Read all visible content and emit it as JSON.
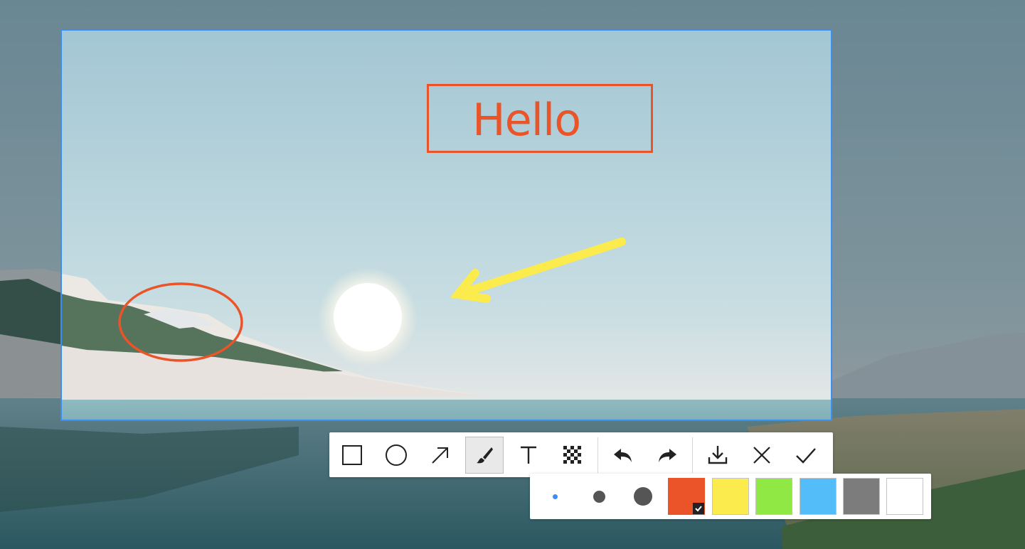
{
  "annotation": {
    "text": "Hello"
  },
  "toolbar": {
    "tools": [
      {
        "name": "rectangle-tool",
        "icon": "square-icon",
        "active": false
      },
      {
        "name": "ellipse-tool",
        "icon": "circle-icon",
        "active": false
      },
      {
        "name": "arrow-tool",
        "icon": "arrow-icon",
        "active": false
      },
      {
        "name": "brush-tool",
        "icon": "brush-icon",
        "active": true
      },
      {
        "name": "text-tool",
        "icon": "text-icon",
        "active": false
      },
      {
        "name": "mosaic-tool",
        "icon": "mosaic-icon",
        "active": false
      }
    ],
    "history": [
      {
        "name": "undo-button",
        "icon": "undo-icon"
      },
      {
        "name": "redo-button",
        "icon": "redo-icon"
      }
    ],
    "actions": [
      {
        "name": "save-button",
        "icon": "download-icon"
      },
      {
        "name": "cancel-button",
        "icon": "close-icon"
      },
      {
        "name": "confirm-button",
        "icon": "check-icon"
      }
    ]
  },
  "palette": {
    "sizes": [
      "small",
      "medium",
      "large"
    ],
    "selected_size": "small",
    "colors": [
      "#ea5428",
      "#fceb4c",
      "#90e845",
      "#52bdf9",
      "#7c7c7c",
      "#ffffff"
    ],
    "selected_color": "#ea5428",
    "accent": "#3b8ff2"
  }
}
